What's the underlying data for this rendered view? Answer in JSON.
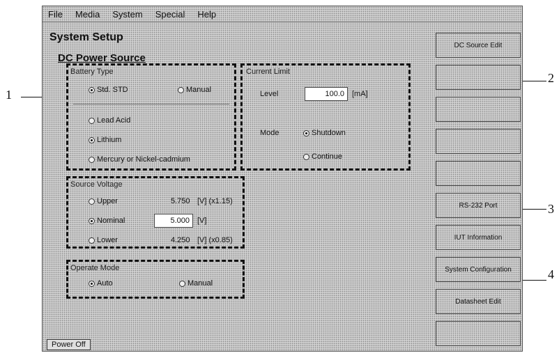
{
  "menu": [
    "File",
    "Media",
    "System",
    "Special",
    "Help"
  ],
  "title": "System Setup",
  "subtitle": "DC Power Source",
  "battery_type": {
    "label": "Battery Type",
    "opt_std": "Std. STD",
    "opt_manual": "Manual",
    "opt_lead": "Lead Acid",
    "opt_lithium": "Lithium",
    "opt_mercury": "Mercury or Nickel-cadmium",
    "selected": "Std. STD / Lithium"
  },
  "current_limit": {
    "label": "Current Limit",
    "level_label": "Level",
    "level_value": "100.0",
    "level_unit": "[mA]",
    "mode_label": "Mode",
    "opt_shutdown": "Shutdown",
    "opt_continue": "Continue"
  },
  "source_voltage": {
    "label": "Source Voltage",
    "upper": "Upper",
    "upper_value": "5.750",
    "upper_unit": "[V] (x1.15)",
    "nominal": "Nominal",
    "nominal_value": "5.000",
    "nominal_unit": "[V]",
    "lower": "Lower",
    "lower_value": "4.250",
    "lower_unit": "[V] (x0.85)"
  },
  "operate_mode": {
    "label": "Operate Mode",
    "auto": "Auto",
    "manual": "Manual"
  },
  "right_buttons": [
    "DC Source Edit",
    "",
    "",
    "",
    "",
    "RS-232 Port",
    "IUT Information",
    "System Configuration",
    "Datasheet Edit",
    ""
  ],
  "bottom_button": "Power Off",
  "callouts": [
    "1",
    "2",
    "3",
    "4"
  ]
}
